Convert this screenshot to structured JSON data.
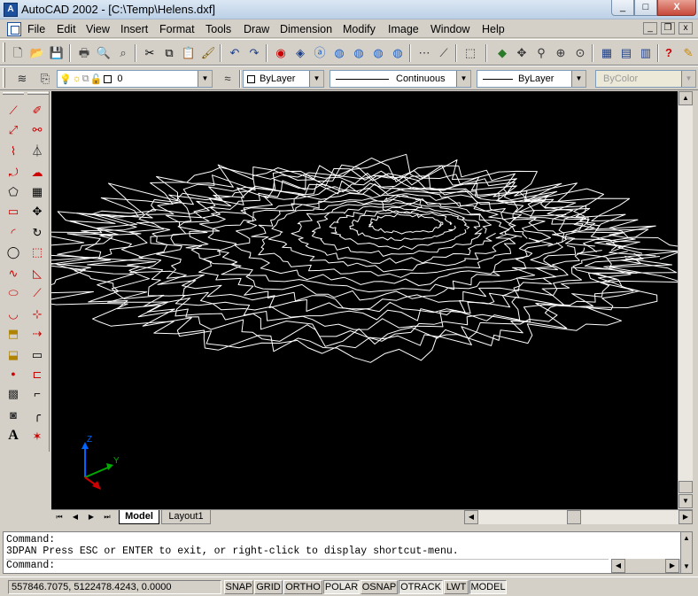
{
  "window": {
    "title": "AutoCAD 2002 - [C:\\Temp\\Helens.dxf]",
    "app_icon_glyph": "A",
    "min_label": "_",
    "max_label": "□",
    "close_label": "X",
    "mdi_min_label": "_",
    "mdi_restore_label": "❐",
    "mdi_close_label": "x"
  },
  "menu": {
    "items": [
      "File",
      "Edit",
      "View",
      "Insert",
      "Format",
      "Tools",
      "Draw",
      "Dimension",
      "Modify",
      "Image",
      "Window",
      "Help"
    ]
  },
  "standard_toolbar": {
    "icons": [
      "new-icon",
      "open-icon",
      "save-icon",
      "plot-icon",
      "plot-preview-icon",
      "find-icon",
      "cut-icon",
      "copy-icon",
      "paste-icon",
      "match-properties-icon",
      "undo-icon",
      "redo-icon",
      "today-icon",
      "meet-now-icon",
      "design-center-icon",
      "point-filter-icon",
      "ucs-icon",
      "aerial-view-icon",
      "named-views-icon",
      "3d-orbit-icon",
      "pan-icon",
      "zoom-realtime-icon",
      "zoom-window-icon",
      "zoom-previous-icon",
      "properties-icon",
      "adcenter-icon",
      "tool-palette-icon",
      "help-icon"
    ]
  },
  "layers_toolbar": {
    "layer_value": "0",
    "color_value": "ByLayer",
    "linetype_value": "Continuous",
    "lineweight_value": "ByLayer",
    "plotstyle_value": "ByColor"
  },
  "draw_toolbar": {
    "icons": [
      "line-icon",
      "construction-line-icon",
      "polyline-icon",
      "polygon-icon",
      "rectangle-icon",
      "arc-icon",
      "circle-icon",
      "spline-icon",
      "ellipse-icon",
      "insert-block-icon",
      "make-block-icon",
      "point-icon",
      "hatch-icon",
      "region-icon",
      "multiline-text-icon"
    ]
  },
  "modify_toolbar": {
    "icons": [
      "erase-icon",
      "copy-object-icon",
      "mirror-icon",
      "offset-icon",
      "array-icon",
      "move-icon",
      "rotate-icon",
      "scale-icon",
      "stretch-icon",
      "lengthen-icon",
      "trim-icon",
      "extend-icon",
      "break-icon",
      "chamfer-icon",
      "fillet-icon",
      "explode-icon"
    ]
  },
  "ucs": {
    "x_label": "X",
    "y_label": "Y",
    "z_label": "Z"
  },
  "layout_tabs": {
    "nav": [
      "⏮",
      "◀",
      "▶",
      "⏭"
    ],
    "tabs": [
      "Model",
      "Layout1"
    ]
  },
  "command_window": {
    "lines": [
      "Command:",
      "3DPAN Press ESC or ENTER to exit, or right-click to display shortcut-menu.",
      "Command:"
    ]
  },
  "status": {
    "coordinates": "557846.7075, 5122478.4243, 0.0000",
    "toggles": [
      "SNAP",
      "GRID",
      "ORTHO",
      "POLAR",
      "OSNAP",
      "OTRACK",
      "LWT",
      "MODEL"
    ],
    "toggles_on": [
      "POLAR",
      "OTRACK",
      "MODEL"
    ]
  },
  "colors": {
    "drawing_background": "#000000",
    "contour": "#ffffff",
    "ucs_x": "#cc0000",
    "ucs_y": "#00aa00",
    "ucs_z": "#0066ff"
  }
}
